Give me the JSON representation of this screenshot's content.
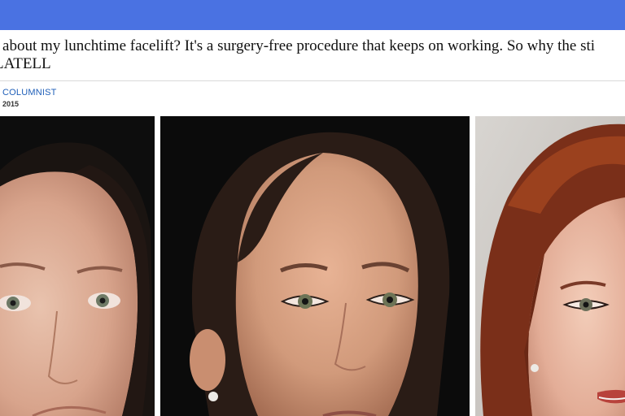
{
  "header": {
    "color": "#4a72e2"
  },
  "article": {
    "headline_line1": "t about my lunchtime facelift? It's a surgery-free procedure that keeps on working. So why the sti",
    "headline_line2": "LATELL",
    "byline": "COLUMNIST",
    "date_fragment": "2015"
  },
  "photos": [
    {
      "name": "before-photo",
      "subject": "woman-face"
    },
    {
      "name": "after-photo",
      "subject": "woman-face"
    },
    {
      "name": "comparison-photo",
      "subject": "woman-red-hair"
    }
  ]
}
